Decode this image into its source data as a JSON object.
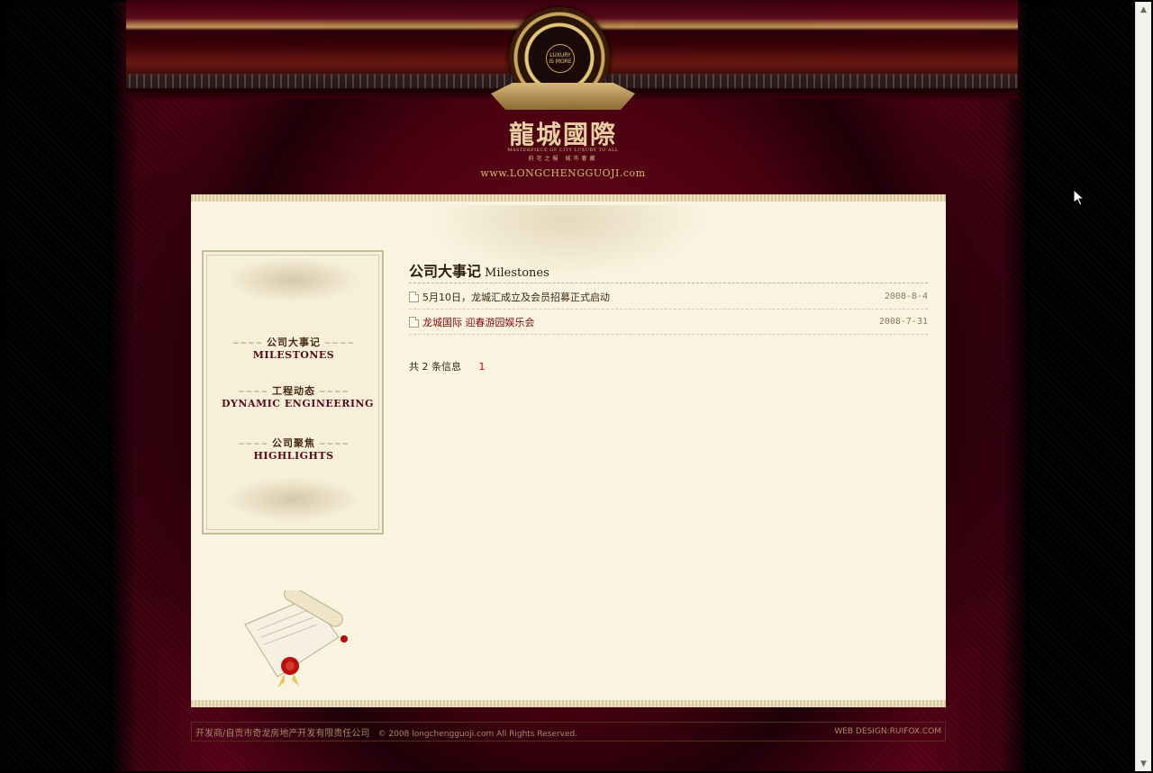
{
  "header": {
    "emblem_text": "LUXURY IS MORE",
    "brand_title": "龍城國際",
    "tagline_en": "MASTERPIECE OF CITY LUXURY TO ALL",
    "tagline_cn": "府宅之擬 城市奢藏",
    "url": "www.LONGCHENGGUOJI.com"
  },
  "sidebar": {
    "items": [
      {
        "cn": "公司大事记",
        "en": "MILESTONES"
      },
      {
        "cn": "工程动态",
        "en": "DYNAMIC ENGINEERING"
      },
      {
        "cn": "公司聚焦",
        "en": "HIGHLIGHTS"
      }
    ]
  },
  "main": {
    "heading_cn": "公司大事记",
    "heading_en": "Milestones",
    "news": [
      {
        "title": "5月10日，龙城汇成立及会员招募正式启动",
        "date": "2008-8-4"
      },
      {
        "title": "龙城国际 迎春游园娱乐会",
        "date": "2008-7-31"
      }
    ],
    "pager_text": "共 2 条信息",
    "pager_page": "1"
  },
  "footer": {
    "company": "开发商/自贡市奇龙房地产开发有限责任公司",
    "copyright": "© 2008 longchengguoji.com All Rights Reserved.",
    "design": "WEB DESIGN:RUIFOX.COM"
  },
  "colors": {
    "background_red": "#5a0018",
    "panel": "#faf3df",
    "gold": "#c9a45c",
    "link_red": "#7a0a0a"
  }
}
